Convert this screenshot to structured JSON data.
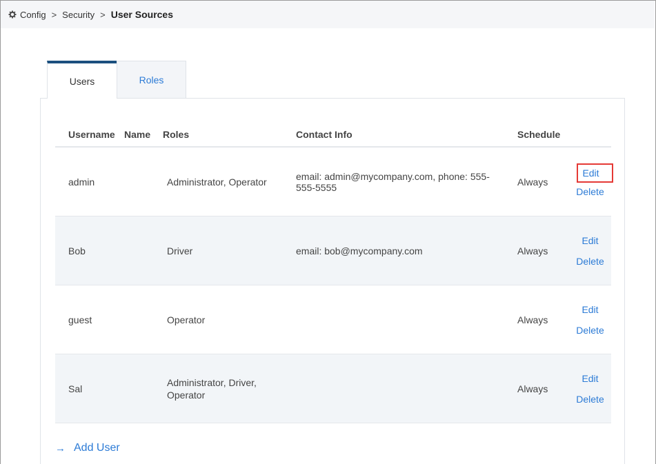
{
  "breadcrumb": {
    "icon": "gear-icon",
    "items": [
      "Config",
      "Security"
    ],
    "separator": ">",
    "current": "User Sources"
  },
  "tabs": [
    {
      "label": "Users",
      "active": true
    },
    {
      "label": "Roles",
      "active": false
    }
  ],
  "table": {
    "headers": {
      "username": "Username",
      "name": "Name",
      "roles": "Roles",
      "contact": "Contact Info",
      "schedule": "Schedule"
    },
    "rows": [
      {
        "username": "admin",
        "name": "",
        "roles": "Administrator, Operator",
        "contact": "email: admin@mycompany.com, phone: 555-555-5555",
        "schedule": "Always",
        "edit": "Edit",
        "delete": "Delete"
      },
      {
        "username": "Bob",
        "name": "",
        "roles": "Driver",
        "contact": "email: bob@mycompany.com",
        "schedule": "Always",
        "edit": "Edit",
        "delete": "Delete"
      },
      {
        "username": "guest",
        "name": "",
        "roles": "Operator",
        "contact": "",
        "schedule": "Always",
        "edit": "Edit",
        "delete": "Delete"
      },
      {
        "username": "Sal",
        "name": "",
        "roles": "Administrator, Driver, Operator",
        "contact": "",
        "schedule": "Always",
        "edit": "Edit",
        "delete": "Delete"
      }
    ]
  },
  "add_user": {
    "arrow": "→",
    "label": "Add User"
  },
  "colors": {
    "accent": "#2c7bd6",
    "tab_active_border": "#1b4f7e",
    "highlight": "#e53935",
    "row_alt": "#f2f5f8"
  }
}
